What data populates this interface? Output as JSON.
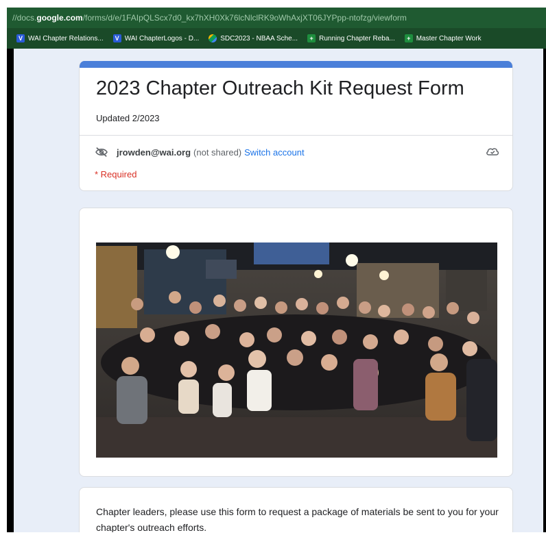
{
  "browser": {
    "url_prefix": "//docs.",
    "url_host": "google.com",
    "url_path": "/forms/d/e/1FAIpQLScx7d0_kx7hXH0Xk76lcNlclRK9oWhAxjXT06JYPpp-ntofzg/viewform",
    "bookmarks": [
      {
        "label": "WAI Chapter Relations...",
        "icon": "blue-v-icon"
      },
      {
        "label": "WAI ChapterLogos - D...",
        "icon": "blue-v-icon"
      },
      {
        "label": "SDC2023 - NBAA Sche...",
        "icon": "google-drive-icon"
      },
      {
        "label": "Running Chapter Reba...",
        "icon": "green-plus-icon"
      },
      {
        "label": "Master Chapter Work",
        "icon": "green-plus-icon"
      }
    ]
  },
  "form": {
    "title": "2023 Chapter Outreach Kit Request Form",
    "description": "Updated 2/2023",
    "account_email": "jrowden@wai.org",
    "account_note": "(not shared)",
    "switch_account": "Switch account",
    "required_note": "* Required",
    "intro_text": "Chapter leaders, please use this form to request a package of materials be sent to you for your chapter's outreach efforts."
  },
  "colors": {
    "accent": "#4a7fd9",
    "link": "#1a73e8",
    "required": "#d93025",
    "page_bg": "#e8eef8",
    "url_bar": "#1f5a31"
  }
}
